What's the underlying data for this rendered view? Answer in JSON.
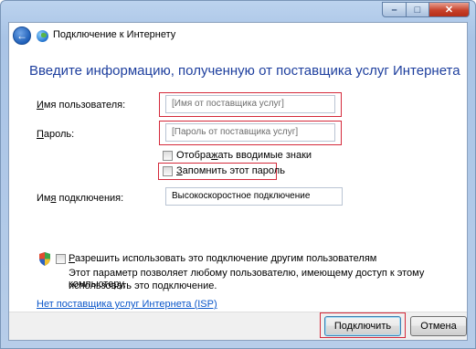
{
  "window": {
    "title": "Подключение к Интернету",
    "controls": {
      "minimize": "–",
      "maximize": "□",
      "close": "✕"
    }
  },
  "nav": {
    "back_icon": "←"
  },
  "main": {
    "heading": "Введите информацию, полученную от поставщика услуг Интернета",
    "username": {
      "label_prefix": "И",
      "label_rest": "мя пользователя:",
      "placeholder": "[Имя от поставщика услуг]"
    },
    "password": {
      "label_prefix": "П",
      "label_rest": "ароль:",
      "placeholder": "[Пароль от поставщика услуг]"
    },
    "show_chars": {
      "label_pre": "Отобра",
      "label_u": "ж",
      "label_post": "ать вводимые знаки",
      "checked": false
    },
    "remember_password": {
      "label_u": "З",
      "label_rest": "апомнить этот пароль",
      "checked": false
    },
    "connection_name": {
      "label_pre": "Им",
      "label_u": "я",
      "label_post": " подключения:",
      "value": "Высокоскоростное подключение"
    },
    "allow_others": {
      "label_u": "Р",
      "label_rest": "азрешить использовать это подключение другим пользователям",
      "note_line1": "Этот параметр позволяет любому пользователю, имеющему доступ к этому компьютеру,",
      "note_line2": "использовать это подключение.",
      "checked": false
    },
    "no_isp_link": "Нет поставщика услуг Интернета (ISP)"
  },
  "footer": {
    "connect_label": "Подключить",
    "cancel_label": "Отмена"
  },
  "colors": {
    "heading": "#1e3f9e",
    "link": "#0a56c9",
    "highlight": "#d42a3b"
  }
}
